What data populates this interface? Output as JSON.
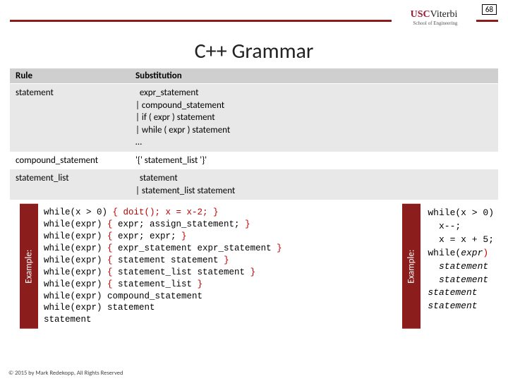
{
  "page_number": "68",
  "logo": {
    "usc": "USC",
    "viterbi": "Viterbi",
    "sub": "School of Engineering"
  },
  "title": "C++ Grammar",
  "table": {
    "h1": "Rule",
    "h2": "Substitution",
    "r1c1": "statement",
    "r1c2": "  expr_statement\n| compound_statement\n| if ( expr ) statement\n| while ( expr ) statement\n…",
    "r2c1": "compound_statement",
    "r2c2": "'{' statement_list '}'",
    "r3c1": "statement_list",
    "r3c2": "  statement\n| statement_list statement"
  },
  "example_label": "Example:",
  "left_example": {
    "l0a": "while(x > 0) ",
    "l0b": "{ doit(); x = x-2; }",
    "l1a": "while(expr) ",
    "l1b": "{",
    "l1c": " expr; assign_statement;",
    "l1d": " }",
    "l2a": "while(expr) ",
    "l2b": "{",
    "l2c": " expr; expr;",
    "l2d": " }",
    "l3a": "while(expr) ",
    "l3b": "{",
    "l3c": " expr_statement expr_statement",
    "l3d": " }",
    "l4a": "while(expr) ",
    "l4b": "{",
    "l4c": " statement statement",
    "l4d": " }",
    "l5a": "while(expr) ",
    "l5b": "{",
    "l5c": " statement_list statement",
    "l5d": " }",
    "l6a": "while(expr) ",
    "l6b": "{",
    "l6c": " statement_list",
    "l6d": " }",
    "l7a": "while(expr) ",
    "l7b": "compound_statement",
    "l8a": "while(expr) ",
    "l8b": "statement",
    "l9": "statement"
  },
  "right_example": {
    "r0": "while(x > 0)",
    "r1": "  x--;",
    "r2": "  x = x + 5;",
    "r3a": "while(",
    "r3b": "expr",
    "r3c": ")",
    "r4": "  statement",
    "r5": "  statement",
    "r6": "statement",
    "r7": "statement"
  },
  "footer": "© 2015 by Mark Redekopp, All Rights Reserved"
}
